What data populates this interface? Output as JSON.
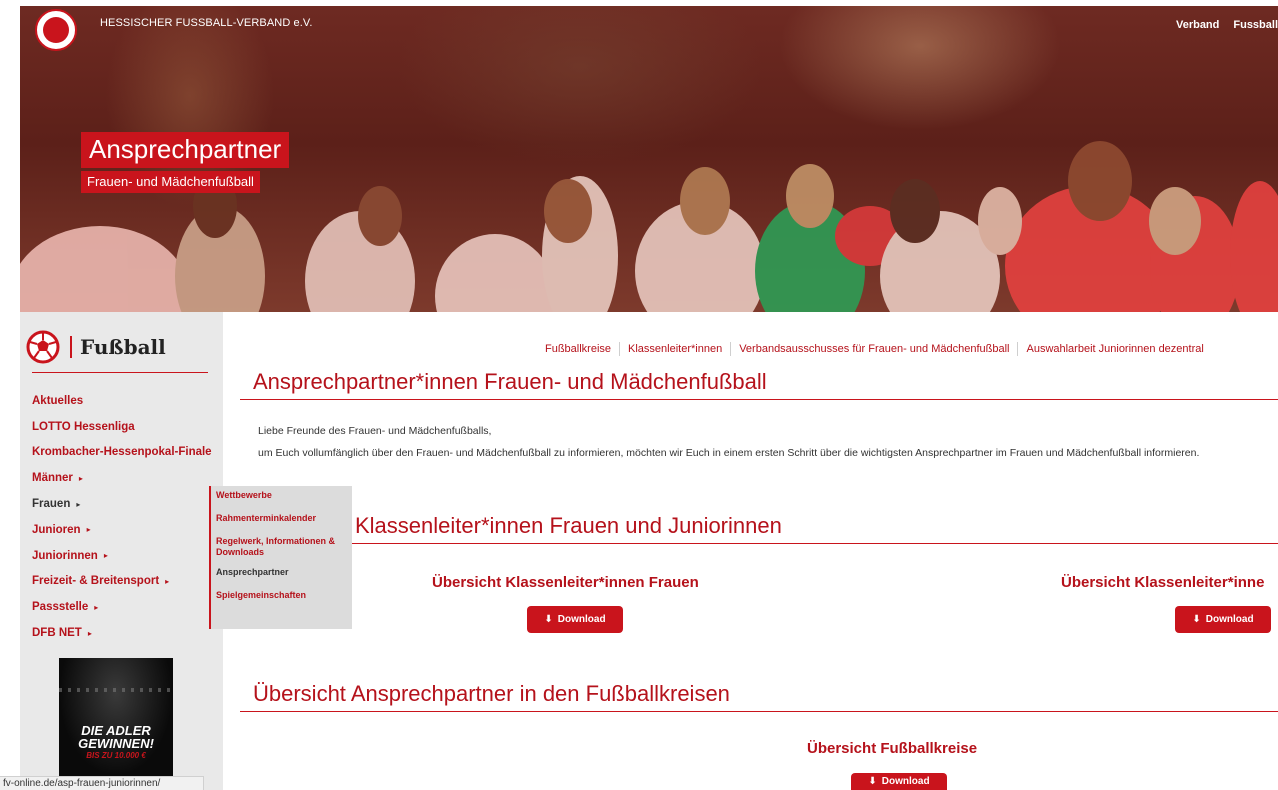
{
  "header": {
    "site_name": "HESSISCHER FUSSBALL-VERBAND e.V.",
    "nav": [
      "Verband",
      "Fussball"
    ]
  },
  "hero": {
    "title": "Ansprechpartner",
    "subtitle": "Frauen- und Mädchenfußball"
  },
  "sidebar": {
    "brand": "Fußball",
    "items": [
      {
        "label": "Aktuelles",
        "has_submenu": false
      },
      {
        "label": "LOTTO Hessenliga",
        "has_submenu": false
      },
      {
        "label": "Krombacher-Hessenpokal-Finale",
        "has_submenu": false
      },
      {
        "label": "Männer",
        "has_submenu": true
      },
      {
        "label": "Frauen",
        "has_submenu": true
      },
      {
        "label": "Junioren",
        "has_submenu": true
      },
      {
        "label": "Juniorinnen",
        "has_submenu": true
      },
      {
        "label": "Freizeit- & Breitensport",
        "has_submenu": true
      },
      {
        "label": "Passstelle",
        "has_submenu": true
      },
      {
        "label": "DFB NET",
        "has_submenu": true
      }
    ],
    "caret": "▸",
    "promo": {
      "line1": "DIE ADLER",
      "line2": "GEWINNEN!",
      "line3": "BIS ZU 10.000 €"
    }
  },
  "submenu": {
    "items": [
      "Wettbewerbe",
      "Rahmenterminkalender",
      "Regelwerk, Informationen & Downloads",
      "Ansprechpartner",
      "Spielgemeinschaften"
    ]
  },
  "subnav": {
    "links": [
      "Fußballkreise",
      "Klassenleiter*innen",
      "Verbandsausschusses für Frauen- und Mädchenfußball",
      "Auswahlarbeit Juniorinnen dezentral"
    ]
  },
  "main": {
    "heading": "Ansprechpartner*innen Frauen- und Mädchenfußball",
    "intro1": "Liebe Freunde des Frauen- und Mädchenfußballs,",
    "intro2": "um Euch vollumfänglich über den Frauen- und Mädchenfußball zu informieren, möchten wir Euch in einem ersten Schritt über die wichtigsten Ansprechpartner im Frauen und Mädchenfußball informieren.",
    "section1": {
      "heading": "Klassenleiter*innen Frauen und Juniorinnen",
      "left_title": "Übersicht Klassenleiter*innen Frauen",
      "right_title": "Übersicht Klassenleiter*inne"
    },
    "section2": {
      "heading": "Übersicht Ansprechpartner in den Fußballkreisen",
      "title": "Übersicht Fußballkreise"
    },
    "download_label": "Download",
    "download_icon": "download-icon"
  },
  "statusbar": {
    "url": "fv-online.de/asp-frauen-juniorinnen/"
  },
  "colors": {
    "accent": "#c9141c",
    "link": "#b5121b",
    "sidebar_bg": "#e9e9e9"
  }
}
